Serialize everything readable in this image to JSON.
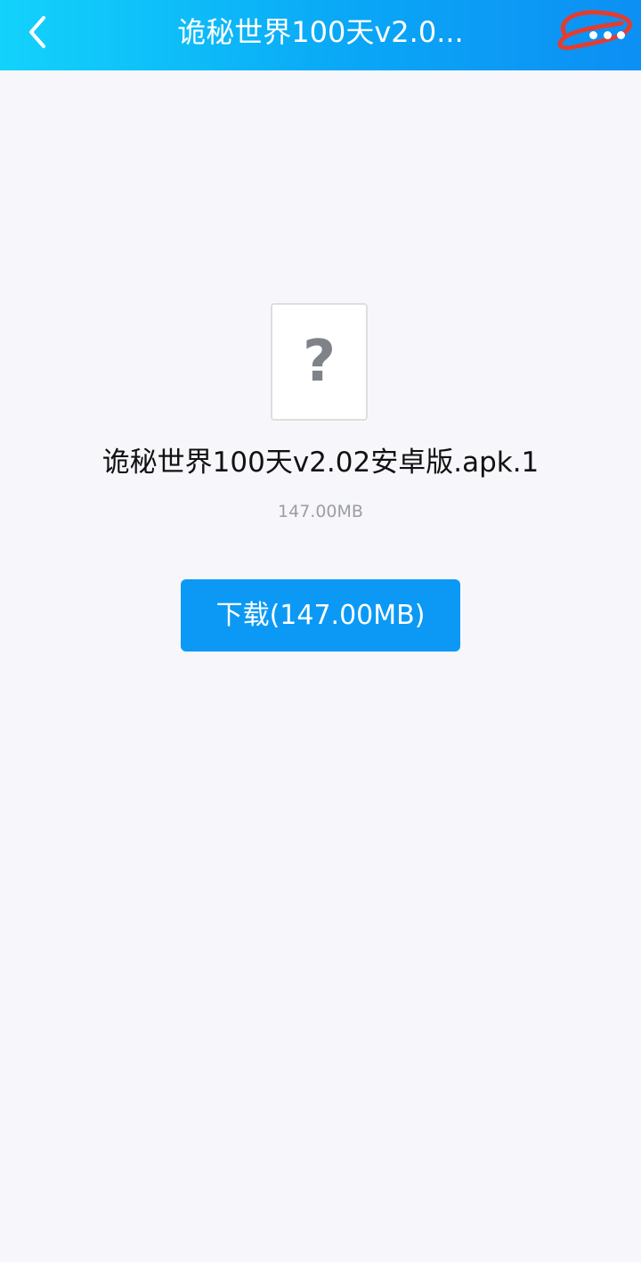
{
  "header": {
    "title": "诡秘世界100天v2.0...",
    "back_icon": "chevron-left-icon",
    "more_icon": "more-dots-icon",
    "bar_color": "#0aa7f6"
  },
  "file": {
    "icon": "unknown-file-question-icon",
    "icon_symbol": "?",
    "name": "诡秘世界100天v2.02安卓版.apk.1",
    "size": "147.00MB"
  },
  "actions": {
    "download_label": "下载(147.00MB)",
    "button_color": "#0b99f5"
  }
}
